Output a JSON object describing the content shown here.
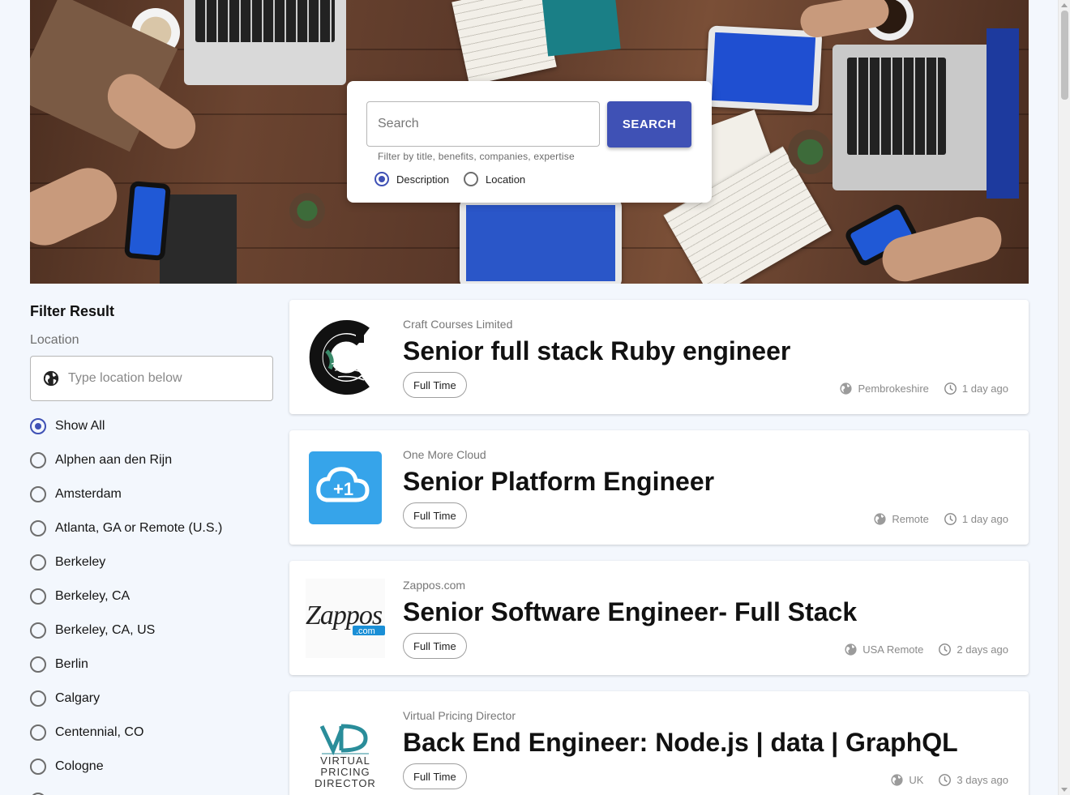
{
  "search": {
    "placeholder": "Search",
    "button_label": "SEARCH",
    "helper_text": "Filter by title, benefits, companies, expertise",
    "options": [
      {
        "label": "Description",
        "checked": true
      },
      {
        "label": "Location",
        "checked": false
      }
    ]
  },
  "sidebar": {
    "title": "Filter Result",
    "location_label": "Location",
    "location_placeholder": "Type location below",
    "locations": [
      {
        "label": "Show All",
        "checked": true
      },
      {
        "label": "Alphen aan den Rijn",
        "checked": false
      },
      {
        "label": "Amsterdam",
        "checked": false
      },
      {
        "label": "Atlanta, GA or Remote (U.S.)",
        "checked": false
      },
      {
        "label": "Berkeley",
        "checked": false
      },
      {
        "label": "Berkeley, CA",
        "checked": false
      },
      {
        "label": "Berkeley, CA, US",
        "checked": false
      },
      {
        "label": "Berlin",
        "checked": false
      },
      {
        "label": "Calgary",
        "checked": false
      },
      {
        "label": "Centennial, CO",
        "checked": false
      },
      {
        "label": "Cologne",
        "checked": false
      }
    ]
  },
  "jobs": [
    {
      "company": "Craft Courses Limited",
      "title": "Senior full stack Ruby engineer",
      "type": "Full Time",
      "location": "Pembrokeshire",
      "posted": "1 day ago",
      "logo_icon": "craft-courses-logo"
    },
    {
      "company": "One More Cloud",
      "title": "Senior Platform Engineer",
      "type": "Full Time",
      "location": "Remote",
      "posted": "1 day ago",
      "logo_icon": "one-more-cloud-logo"
    },
    {
      "company": "Zappos.com",
      "title": "Senior Software Engineer- Full Stack",
      "type": "Full Time",
      "location": "USA Remote",
      "posted": "2 days ago",
      "logo_icon": "zappos-logo"
    },
    {
      "company": "Virtual Pricing Director",
      "title": "Back End Engineer: Node.js | data | GraphQL",
      "type": "Full Time",
      "location": "UK",
      "posted": "3 days ago",
      "logo_icon": "virtual-pricing-director-logo"
    }
  ],
  "colors": {
    "accent": "#3f51b5",
    "background": "#f3f7fd"
  }
}
